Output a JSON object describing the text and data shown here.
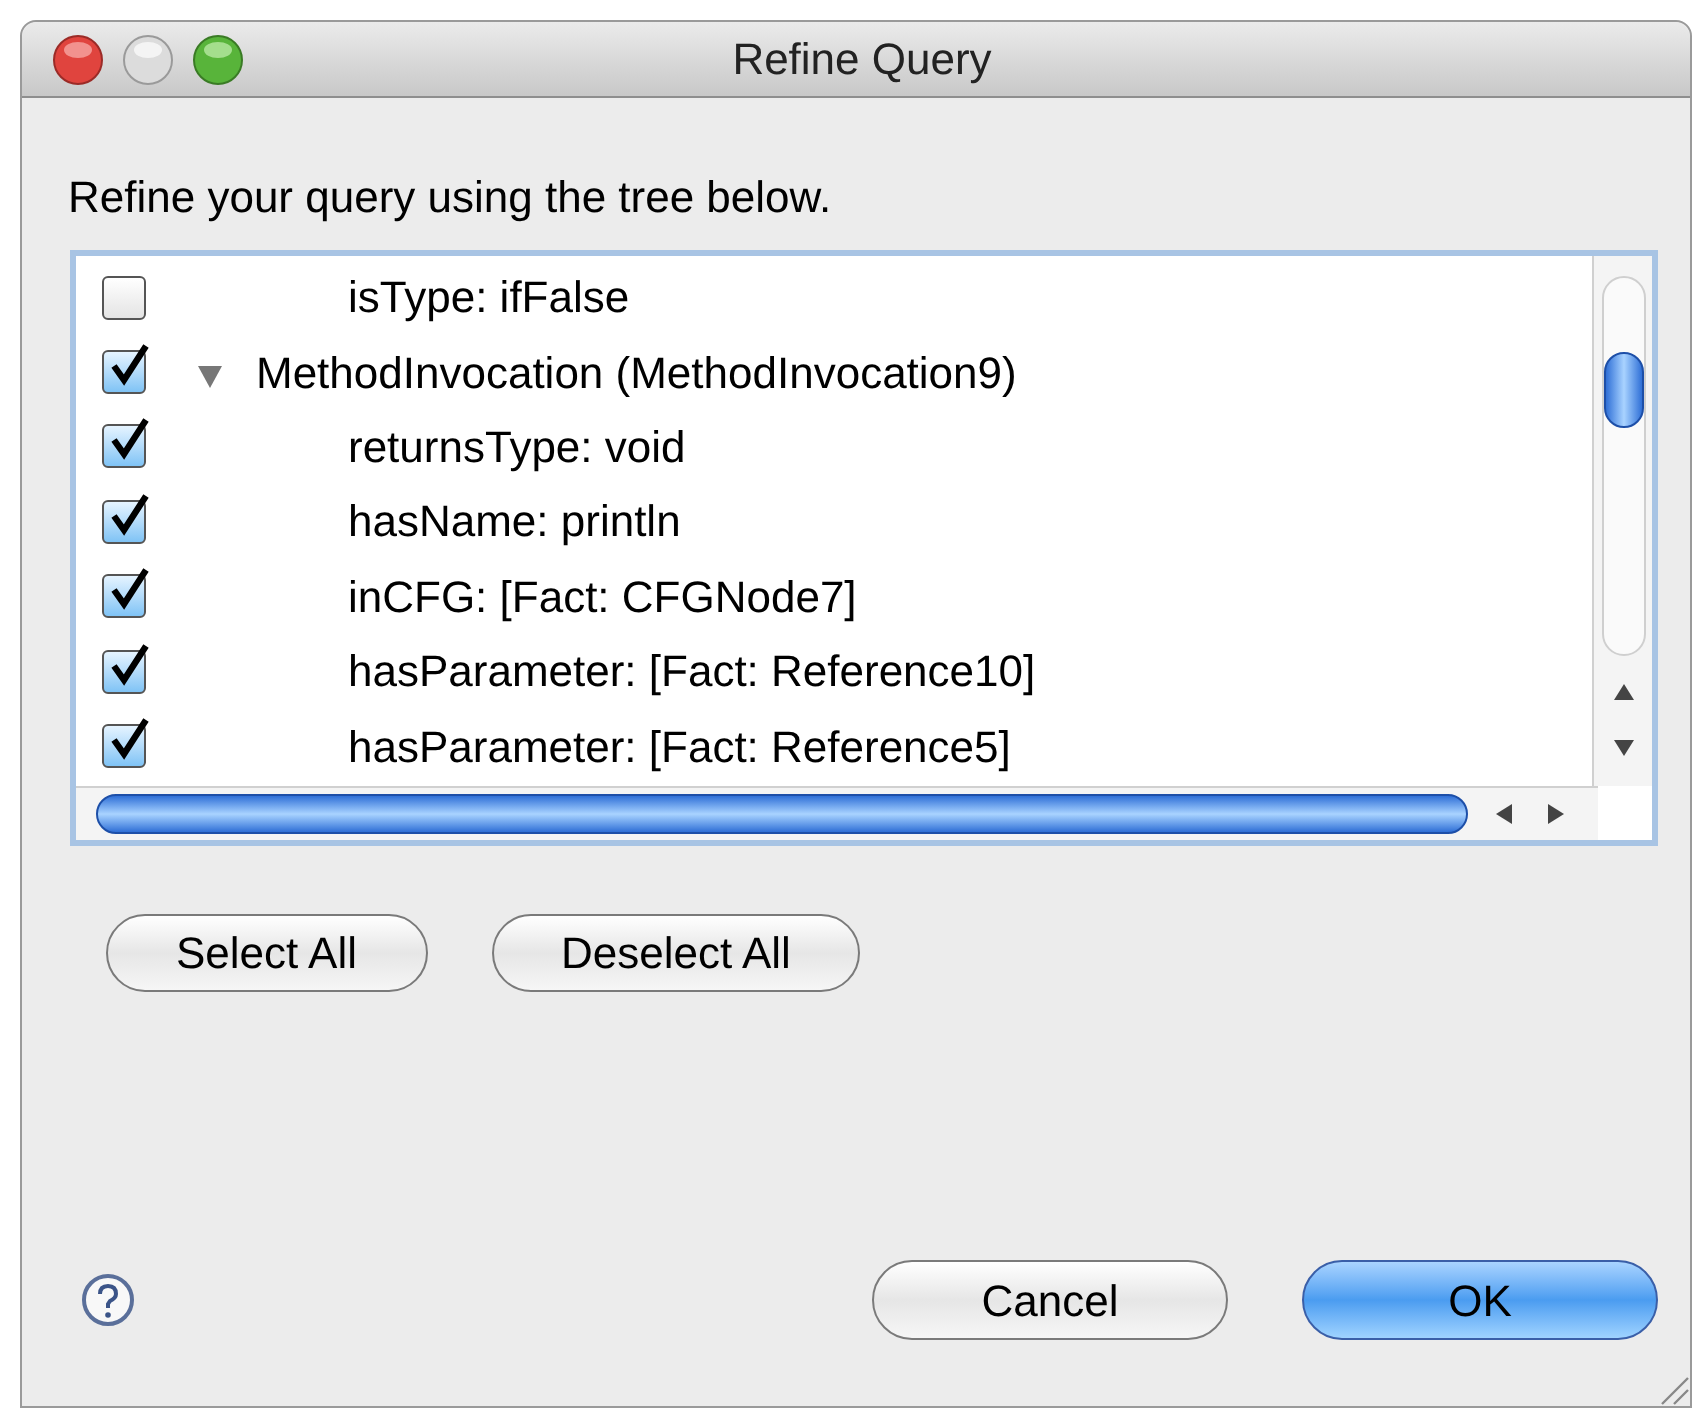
{
  "window": {
    "title": "Refine Query"
  },
  "prompt": "Refine your query using the tree below.",
  "tree": [
    {
      "children": [
        {
          "label": "isType: ifFalse",
          "checked": false
        }
      ]
    },
    {
      "label": "MethodInvocation (MethodInvocation9)",
      "checked": true,
      "expanded": true,
      "children": [
        {
          "label": "returnsType: void",
          "checked": true
        },
        {
          "label": "hasName: println",
          "checked": true
        },
        {
          "label": "inCFG: [Fact: CFGNode7]",
          "checked": true
        },
        {
          "label": "hasParameter: [Fact: Reference10]",
          "checked": true
        },
        {
          "label": "hasParameter: [Fact: Reference5]",
          "checked": true
        }
      ]
    }
  ],
  "selection_buttons": [
    "Select All",
    "Deselect All"
  ],
  "buttons": [
    {
      "label": "Cancel",
      "kind": "normal"
    },
    {
      "label": "OK",
      "kind": "default"
    }
  ]
}
